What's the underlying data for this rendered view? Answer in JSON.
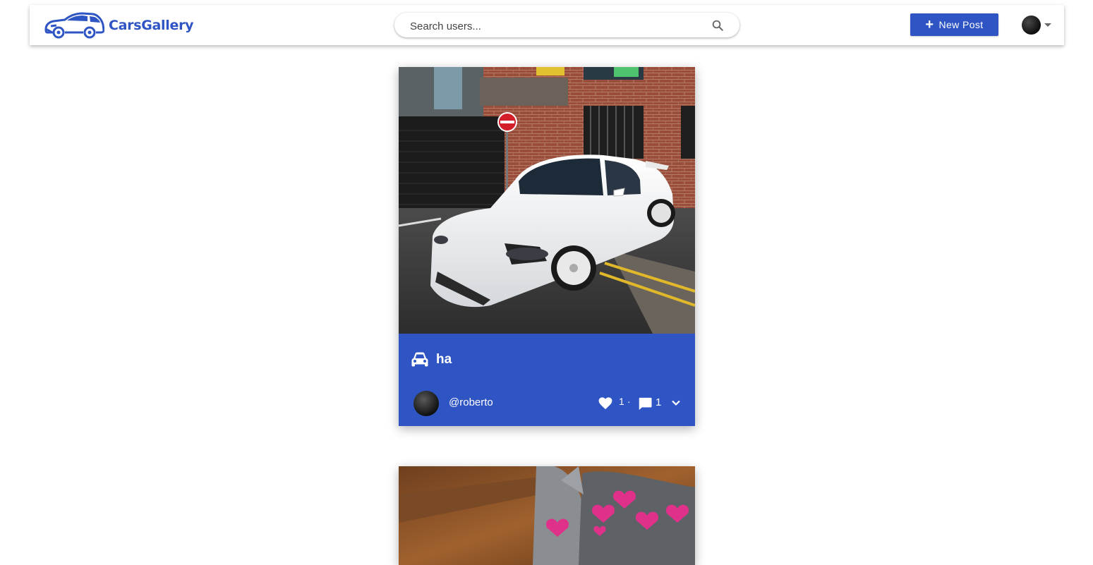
{
  "app": {
    "name": "CarsGallery",
    "brand_color": "#2f55c4",
    "logo_icon": "car-logo-icon"
  },
  "search": {
    "placeholder": "Search users...",
    "icon": "search-icon"
  },
  "toolbar": {
    "new_post_label": "New Post",
    "new_post_icon": "plus-icon"
  },
  "user_menu": {
    "avatar": "user-avatar",
    "icon": "caret-down-icon"
  },
  "posts": [
    {
      "title": "ha",
      "title_icon": "car-icon",
      "author": "@roberto",
      "likes": "1",
      "separator": "·",
      "comments": "1",
      "like_icon": "heart-icon",
      "comment_icon": "comment-icon",
      "expand_icon": "chevron-down-icon",
      "image": "white sports car photo"
    },
    {
      "image": "cat photo with hearts"
    }
  ]
}
